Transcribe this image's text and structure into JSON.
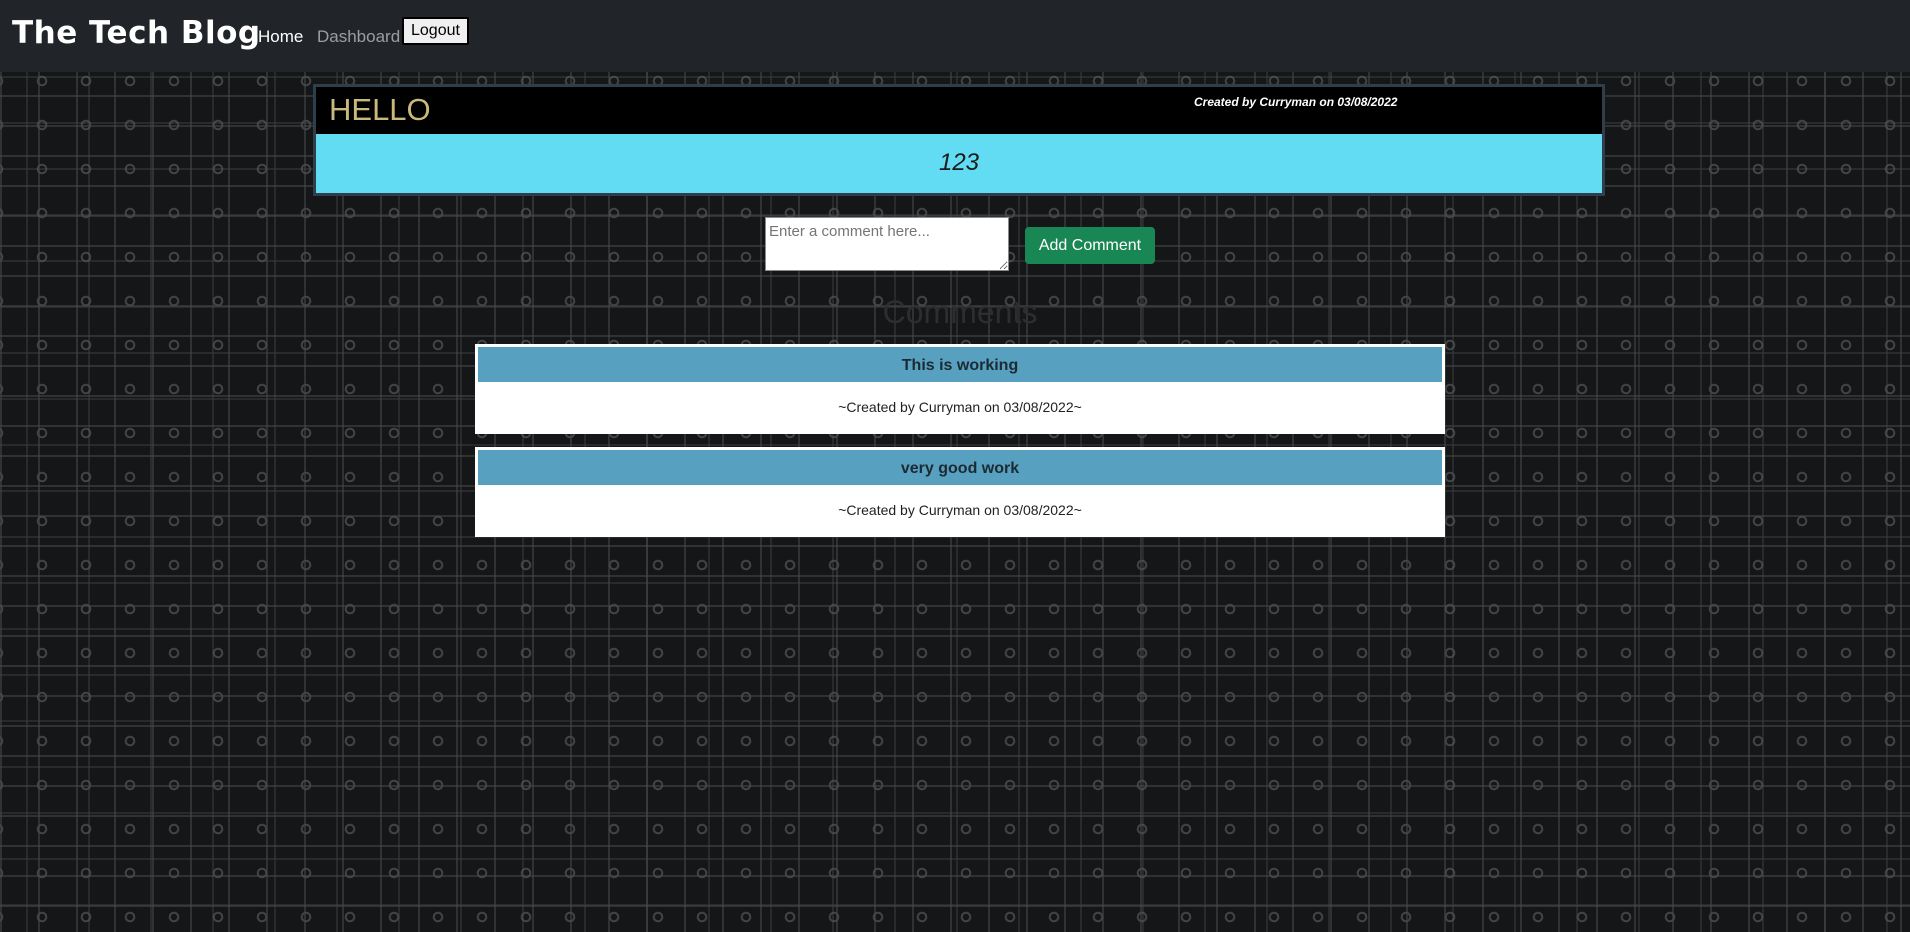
{
  "navbar": {
    "brand": "The Tech Blog",
    "links": [
      "Home",
      "Dashboard"
    ],
    "logout_label": "Logout"
  },
  "post": {
    "title": "HELLO",
    "meta": "Created by Curryman on 03/08/2022",
    "content": "123"
  },
  "comment_form": {
    "placeholder": "Enter a comment here...",
    "value": "",
    "submit_label": "Add Comment"
  },
  "comments_heading": "Comments",
  "comments": [
    {
      "text": "This is working",
      "meta": "~Created by Curryman on 03/08/2022~"
    },
    {
      "text": "very good work",
      "meta": "~Created by Curryman on 03/08/2022~"
    }
  ],
  "colors": {
    "navbar_bg": "#212529",
    "post_title": "#c9b97a",
    "post_body_bg": "#61dcf2",
    "comment_head_bg": "#57a0bf",
    "button_green": "#198754"
  }
}
